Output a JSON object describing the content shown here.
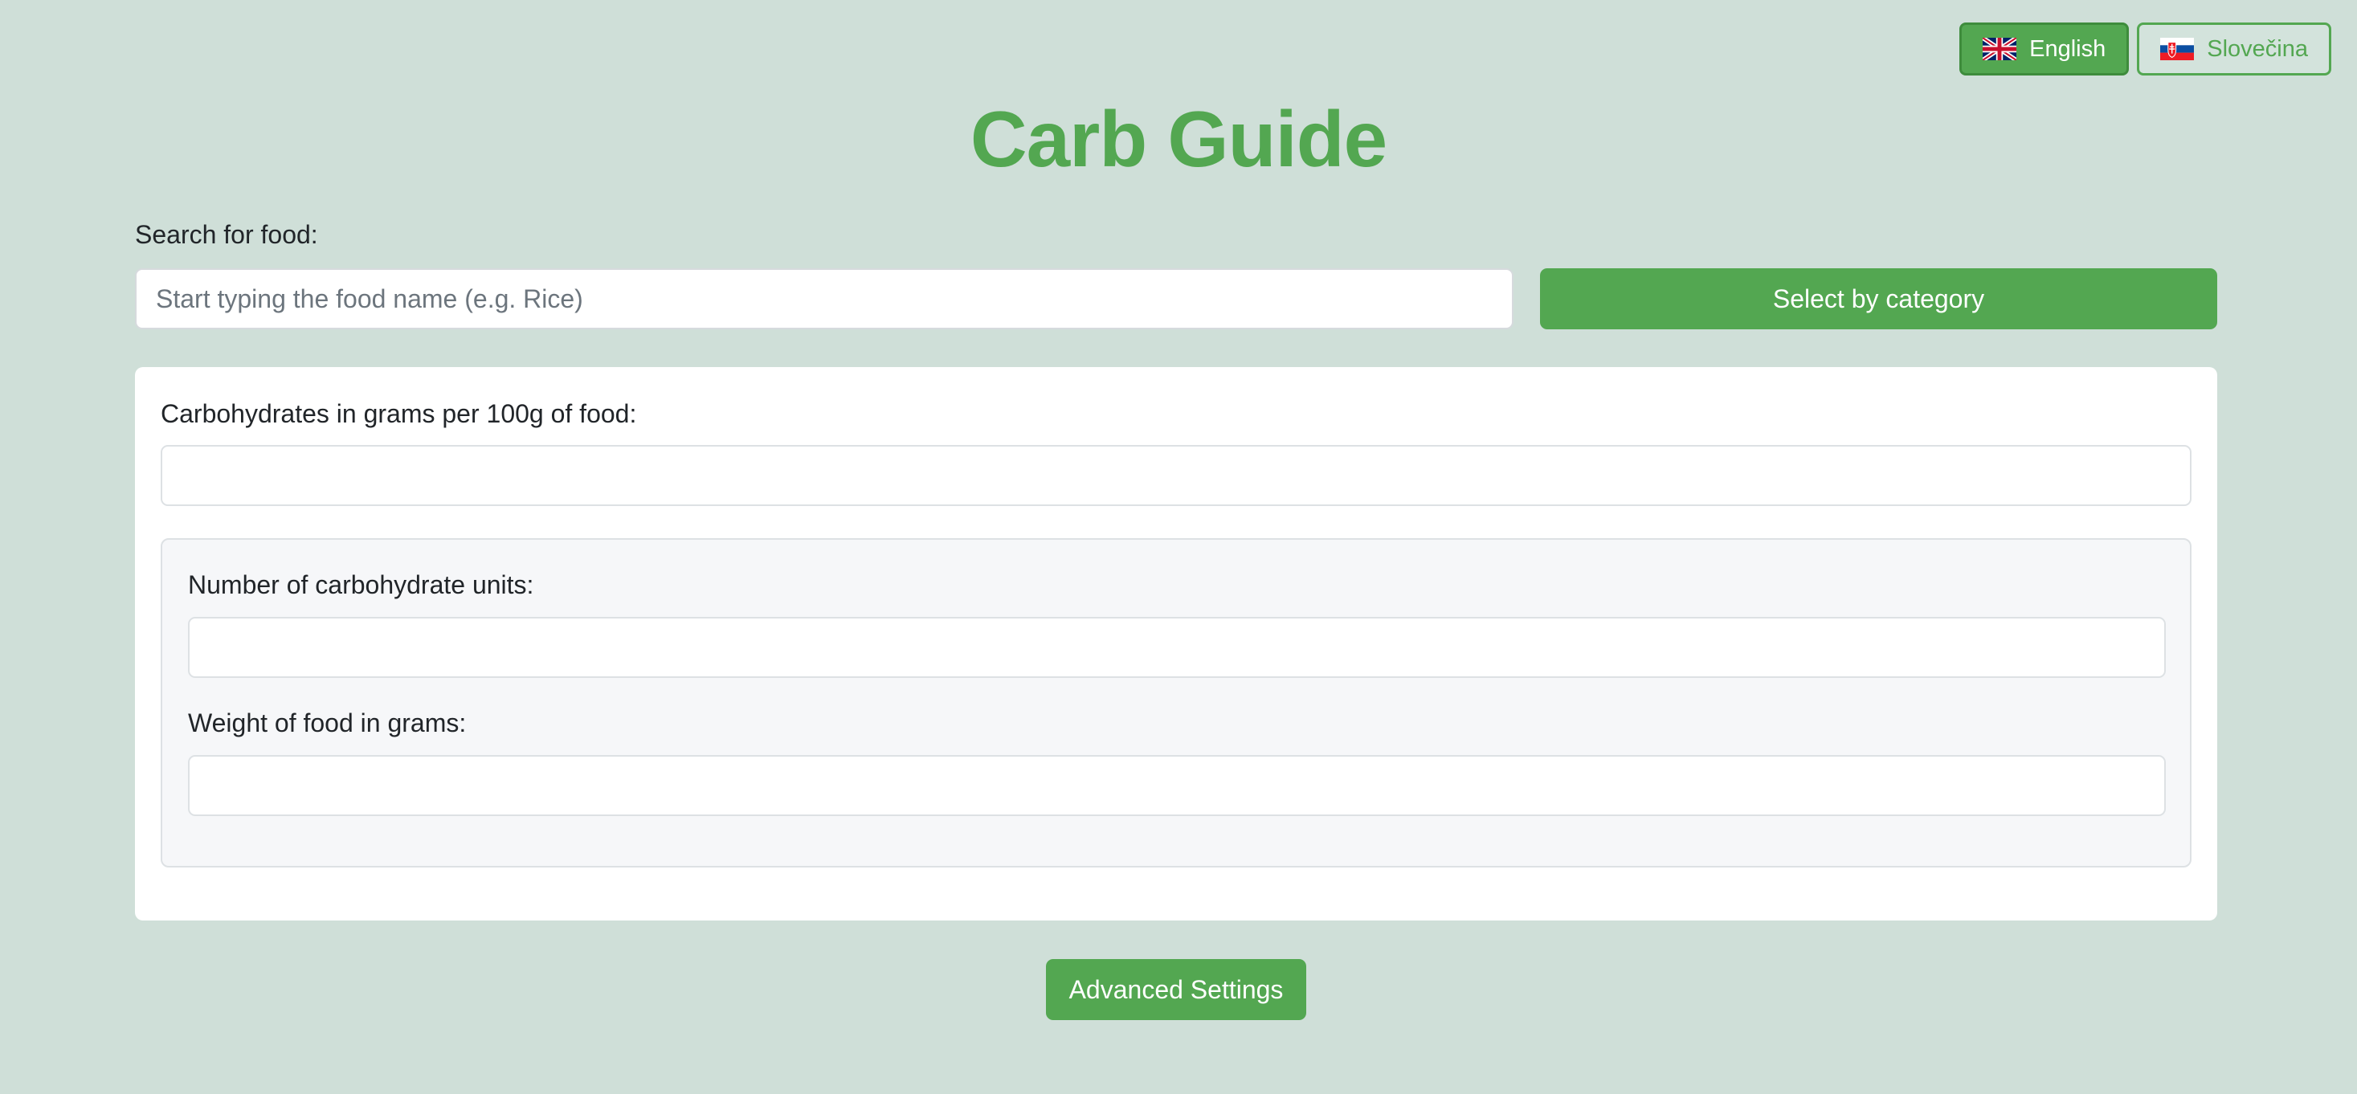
{
  "languages": [
    {
      "label": "English",
      "flag": "uk-flag-icon",
      "active": true
    },
    {
      "label": "Slovečina",
      "flag": "slovakia-flag-icon",
      "active": false
    }
  ],
  "title": "Carb Guide",
  "search": {
    "label": "Search for food:",
    "placeholder": "Start typing the food name (e.g. Rice)",
    "value": ""
  },
  "category_button": "Select by category",
  "carbs_per_100g": {
    "label": "Carbohydrates in grams per 100g of food:",
    "value": ""
  },
  "carb_units": {
    "label": "Number of carbohydrate units:",
    "value": ""
  },
  "food_weight": {
    "label": "Weight of food in grams:",
    "value": ""
  },
  "advanced_button": "Advanced Settings",
  "colors": {
    "background": "#cfdfd8",
    "accent": "#53a751",
    "card": "#ffffff",
    "panel": "#f6f7f9"
  }
}
